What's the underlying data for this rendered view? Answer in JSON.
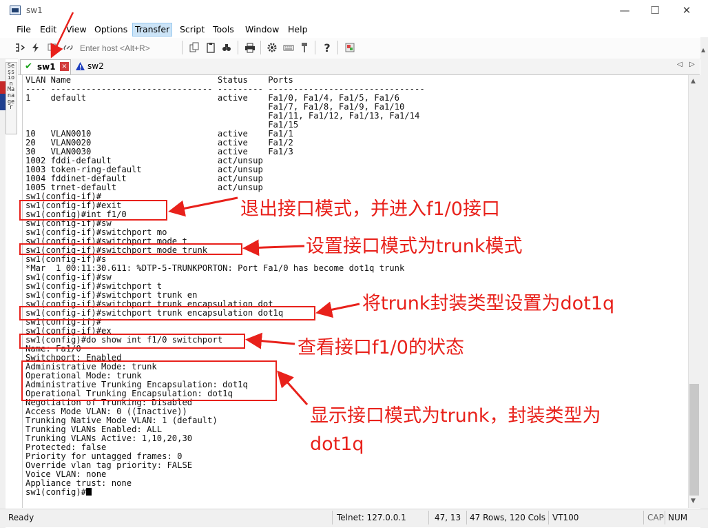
{
  "window": {
    "title": "sw1",
    "minimize_glyph": "—",
    "maximize_glyph": "☐",
    "close_glyph": "✕"
  },
  "menu": [
    "File",
    "Edit",
    "View",
    "Options",
    "Transfer",
    "Script",
    "Tools",
    "Window",
    "Help"
  ],
  "toolbar": {
    "host_placeholder": "Enter host <Alt+R>"
  },
  "session_manager": {
    "label": "Session Manager"
  },
  "tabs": [
    {
      "label": "sw1",
      "status_icon": "check-icon",
      "active": true
    },
    {
      "label": "sw2",
      "status_icon": "warning-icon",
      "active": false
    }
  ],
  "terminal": {
    "lines": [
      "VLAN Name                             Status    Ports",
      "---- -------------------------------- --------- -------------------------------",
      "1    default                          active    Fa1/0, Fa1/4, Fa1/5, Fa1/6",
      "                                                Fa1/7, Fa1/8, Fa1/9, Fa1/10",
      "                                                Fa1/11, Fa1/12, Fa1/13, Fa1/14",
      "                                                Fa1/15",
      "10   VLAN0010                         active    Fa1/1",
      "20   VLAN0020                         active    Fa1/2",
      "30   VLAN0030                         active    Fa1/3",
      "1002 fddi-default                     act/unsup",
      "1003 token-ring-default               act/unsup",
      "1004 fddinet-default                  act/unsup",
      "1005 trnet-default                    act/unsup",
      "sw1(config-if)#",
      "sw1(config-if)#exit",
      "sw1(config)#int f1/0",
      "sw1(config-if)#sw",
      "sw1(config-if)#switchport mo",
      "sw1(config-if)#switchport mode t",
      "sw1(config-if)#switchport mode trunk",
      "sw1(config-if)#s",
      "*Mar  1 00:11:30.611: %DTP-5-TRUNKPORTON: Port Fa1/0 has become dot1q trunk",
      "sw1(config-if)#sw",
      "sw1(config-if)#switchport t",
      "sw1(config-if)#switchport trunk en",
      "sw1(config-if)#switchport trunk encapsulation dot",
      "sw1(config-if)#switchport trunk encapsulation dot1q",
      "sw1(config-if)#",
      "sw1(config-if)#ex",
      "sw1(config)#do show int f1/0 switchport",
      "Name: Fa1/0",
      "Switchport: Enabled",
      "Administrative Mode: trunk",
      "Operational Mode: trunk",
      "Administrative Trunking Encapsulation: dot1q",
      "Operational Trunking Encapsulation: dot1q",
      "Negotiation of Trunking: Disabled",
      "Access Mode VLAN: 0 ((Inactive))",
      "Trunking Native Mode VLAN: 1 (default)",
      "Trunking VLANs Enabled: ALL",
      "Trunking VLANs Active: 1,10,20,30",
      "Protected: false",
      "Priority for untagged frames: 0",
      "Override vlan tag priority: FALSE",
      "Voice VLAN: none",
      "Appliance trust: none"
    ],
    "prompt": "sw1(config)#"
  },
  "annotations": {
    "exit_int": "退出接口模式，并进入f1/0接口",
    "mode_trunk": "设置接口模式为trunk模式",
    "encapsulation": "将trunk封装类型设置为dot1q",
    "show_status": "查看接口f1/0的状态",
    "result_line1": "显示接口模式为trunk，封装类型为",
    "result_line2": "dot1q"
  },
  "status_bar": {
    "state": "Ready",
    "connection": "Telnet: 127.0.0.1",
    "cursor": "47, 13",
    "size": "47 Rows, 120 Cols",
    "emulation": "VT100",
    "caps": "CAP",
    "num": "NUM"
  },
  "colors": {
    "annotation_red": "#e8211b",
    "tab_check_green": "#1aa31a",
    "warning_blue": "#1f3fbf"
  }
}
